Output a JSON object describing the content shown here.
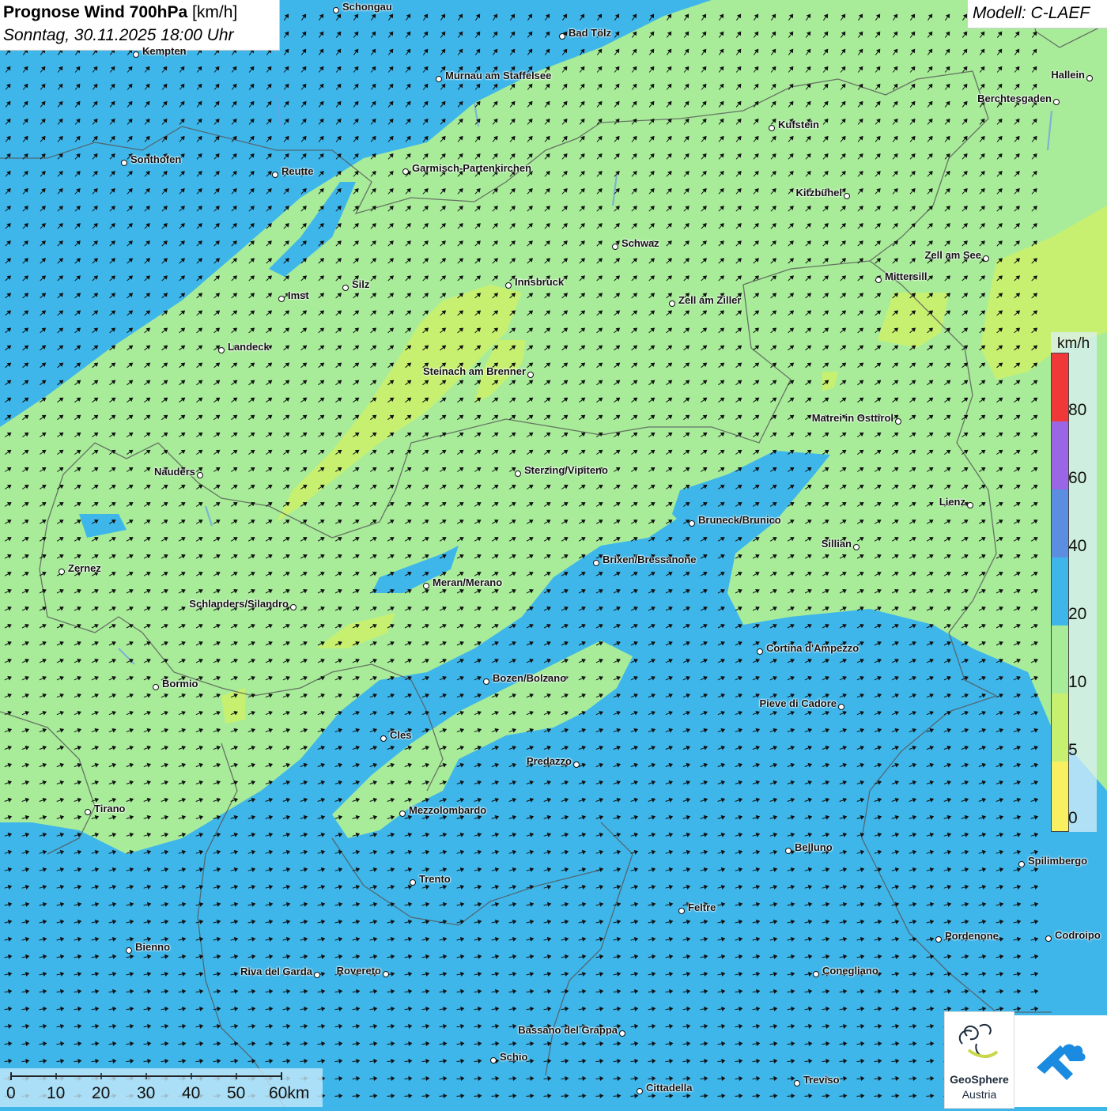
{
  "header": {
    "title_bold": "Prognose Wind 700hPa",
    "title_unit": "[km/h]",
    "datetime": "Sonntag, 30.11.2025 18:00 Uhr",
    "model": "Modell: C-LAEF"
  },
  "legend": {
    "unit": "km/h",
    "ticks": [
      "80",
      "60",
      "40",
      "20",
      "10",
      "5",
      "0"
    ],
    "colors": {
      "0_5": "#f8f060",
      "5_10": "#c8f070",
      "10_20": "#a8ec9a",
      "20_40": "#3fb6ea",
      "40_60": "#5b8ee0",
      "60_80": "#9a66e6",
      "80_plus": "#f03838"
    }
  },
  "scalebar": {
    "labels": [
      "0",
      "10",
      "20",
      "30",
      "40",
      "50",
      "60km"
    ]
  },
  "cities": [
    {
      "name": "Schongau"
    },
    {
      "name": "Bad Tölz"
    },
    {
      "name": "Kempten"
    },
    {
      "name": "Murnau am Staffelsee"
    },
    {
      "name": "Hallein"
    },
    {
      "name": "Berchtesgaden"
    },
    {
      "name": "Kufstein"
    },
    {
      "name": "Sonthofen"
    },
    {
      "name": "Reutte"
    },
    {
      "name": "Garmisch-Partenkirchen"
    },
    {
      "name": "Kitzbühel"
    },
    {
      "name": "Schwaz"
    },
    {
      "name": "Zell am See"
    },
    {
      "name": "Mittersill"
    },
    {
      "name": "Innsbruck"
    },
    {
      "name": "Silz"
    },
    {
      "name": "Imst"
    },
    {
      "name": "Zell am Ziller"
    },
    {
      "name": "Landeck"
    },
    {
      "name": "Steinach am Brenner"
    },
    {
      "name": "Matrei in Osttirol"
    },
    {
      "name": "Nauders"
    },
    {
      "name": "Sterzing/Vipiteno"
    },
    {
      "name": "Lienz"
    },
    {
      "name": "Bruneck/Brunico"
    },
    {
      "name": "Sillian"
    },
    {
      "name": "Zernez"
    },
    {
      "name": "Brixen/Bressanone"
    },
    {
      "name": "Meran/Merano"
    },
    {
      "name": "Schlanders/Silandro"
    },
    {
      "name": "Cortina d'Ampezzo"
    },
    {
      "name": "Bozen/Bolzano"
    },
    {
      "name": "Bormio"
    },
    {
      "name": "Pieve di Cadore"
    },
    {
      "name": "Cles"
    },
    {
      "name": "Predazzo"
    },
    {
      "name": "Tirano"
    },
    {
      "name": "Mezzolombardo"
    },
    {
      "name": "Belluno"
    },
    {
      "name": "Spilimbergo"
    },
    {
      "name": "Trento"
    },
    {
      "name": "Feltre"
    },
    {
      "name": "Bienno"
    },
    {
      "name": "Pordenone"
    },
    {
      "name": "Codroipo"
    },
    {
      "name": "Riva del Garda"
    },
    {
      "name": "Rovereto"
    },
    {
      "name": "Conegliano"
    },
    {
      "name": "Bassano del Grappa"
    },
    {
      "name": "Schio"
    },
    {
      "name": "Treviso"
    },
    {
      "name": "Cittadella"
    }
  ],
  "logos": {
    "geosphere_line1": "GeoSphere",
    "geosphere_line2": "Austria"
  }
}
